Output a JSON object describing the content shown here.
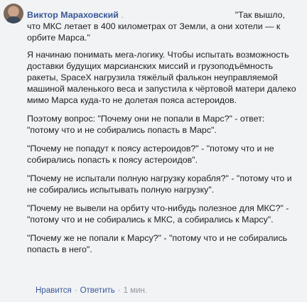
{
  "comment": {
    "author": "Виктор Мараховский",
    "quote_prefix": "\"Так вышло, что МКС летает в 400 километрах от Земли, а они хотели — к орбите Марса.\"",
    "paragraphs": [
      "Я начинаю понимать мега-логику. Чтобы испытать возможность доставки будущих марсианских миссий и грузоподъёмность ракеты, SpaceX нагрузила тяжёлый фалькон неуправляемой машиной маленького веса и запустила к чёртовой матери далеко мимо Марса куда-то не долетая пояса астероидов.",
      "Поэтому вопрос: \"Почему они не попали в Марс?\" - ответ: \"потому что и не собирались попасть в Марс\".",
      "\"Почему не попадут к поясу астероидов?\" - \"потому что и не собирались попасть к поясу астероидов\".",
      "\"Почему не испытали полную нагрузку корабля?\" - \"потому что и не собирались испытывать полную нагрузку\".",
      "\"Почему не вывели на орбиту что-нибудь полезное для МКС?\" - \"потому что и не собирались к МКС, а собирались к Марсу\".",
      "\"Почему же не попали к Марсу?\" - \"потому что и не собирались попасть в него\"."
    ]
  },
  "actions": {
    "like": "Нравится",
    "reply": "Ответить",
    "time": "1 мин."
  }
}
